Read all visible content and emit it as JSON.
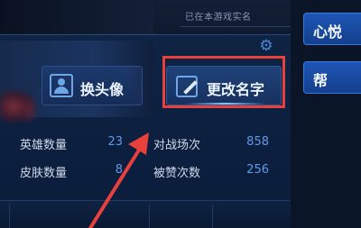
{
  "header": {
    "verified_text": "已在本游戏实名"
  },
  "profile": {
    "change_avatar_label": "换头像",
    "change_name_label": "更改名字"
  },
  "stats": {
    "hero_count_label": "英雄数量",
    "hero_count_value": "23",
    "battles_label": "对战场次",
    "battles_value": "858",
    "skin_count_label": "皮肤数量",
    "skin_count_value": "8",
    "likes_label": "被赞次数",
    "likes_value": "256"
  },
  "right_menu": {
    "item1_label": "心悦",
    "item2_label": "帮"
  },
  "colors": {
    "highlight": "#e8403c",
    "stat_value": "#5e9ae6",
    "button_blue": "#1e56b6"
  },
  "icons": {
    "settings": "gear-icon",
    "avatar": "avatar-icon",
    "edit": "pencil-icon"
  }
}
